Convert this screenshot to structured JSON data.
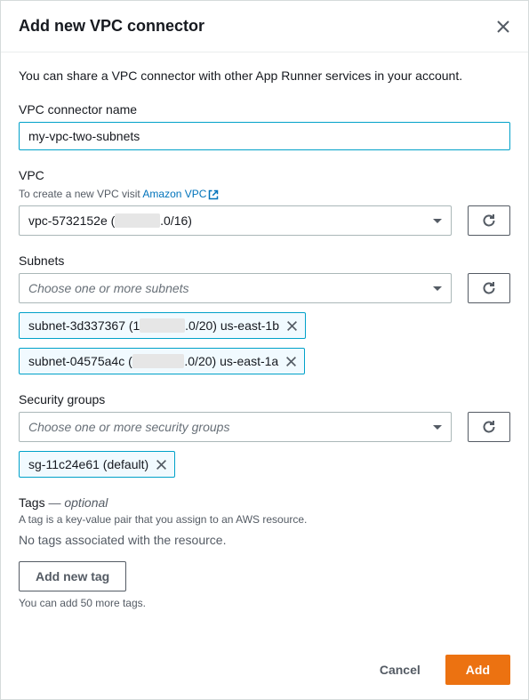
{
  "header": {
    "title": "Add new VPC connector"
  },
  "intro": "You can share a VPC connector with other App Runner services in your account.",
  "vpcConnectorName": {
    "label": "VPC connector name",
    "value": "my-vpc-two-subnets"
  },
  "vpc": {
    "label": "VPC",
    "hintPrefix": "To create a new VPC visit ",
    "hintLink": "Amazon VPC",
    "selectedPrefix": "vpc-5732152e (",
    "selectedSuffix": ".0/16)"
  },
  "subnets": {
    "label": "Subnets",
    "placeholder": "Choose one or more subnets",
    "chips": [
      {
        "prefix": "subnet-3d337367 (1",
        "suffix": ".0/20) us-east-1b"
      },
      {
        "prefix": "subnet-04575a4c (",
        "suffix": ".0/20) us-east-1a"
      }
    ]
  },
  "securityGroups": {
    "label": "Security groups",
    "placeholder": "Choose one or more security groups",
    "chips": [
      {
        "label": "sg-11c24e61 (default)"
      }
    ]
  },
  "tags": {
    "title": "Tags",
    "optional": "— optional",
    "desc": "A tag is a key-value pair that you assign to an AWS resource.",
    "empty": "No tags associated with the resource.",
    "addButton": "Add new tag",
    "limit": "You can add 50 more tags."
  },
  "footer": {
    "cancel": "Cancel",
    "add": "Add"
  }
}
